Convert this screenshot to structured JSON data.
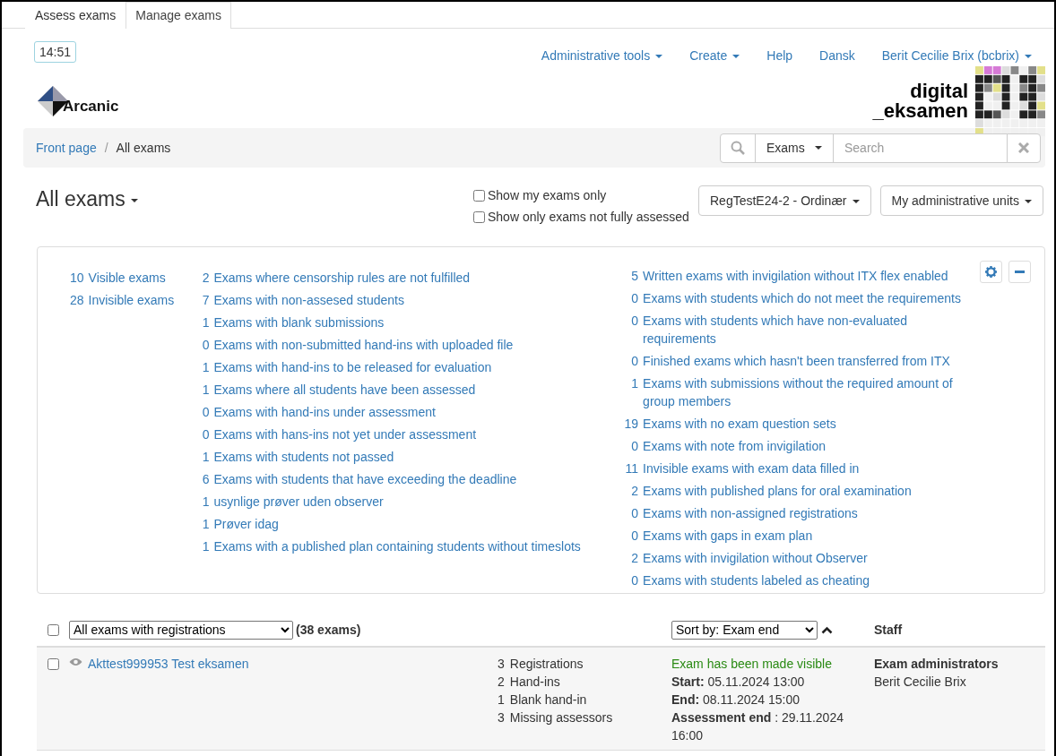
{
  "tabs": [
    {
      "label": "Assess exams",
      "selected": false
    },
    {
      "label": "Manage exams",
      "selected": true
    }
  ],
  "clock": "14:51",
  "nav": [
    {
      "label": "Administrative tools",
      "dropdown": true
    },
    {
      "label": "Create",
      "dropdown": true
    },
    {
      "label": "Help",
      "dropdown": false
    },
    {
      "label": "Dansk",
      "dropdown": false
    },
    {
      "label": "Berit Cecilie Brix (bcbrix)",
      "dropdown": true
    }
  ],
  "brand": {
    "left": "Arcanic",
    "right_line_1": "digital",
    "right_line_2": "_eksamen"
  },
  "breadcrumb": [
    {
      "label": "Front page",
      "link": true
    },
    {
      "label": "All exams",
      "link": false
    }
  ],
  "breadcrumb_separator": "/",
  "search": {
    "scope": "Exams",
    "placeholder": "Search"
  },
  "title": "All exams",
  "filters": [
    {
      "label": "Show my exams only",
      "checked": false
    },
    {
      "label": "Show only exams not fully assessed",
      "checked": false
    }
  ],
  "dropdowns": [
    "RegTestE24-2 - Ordinær",
    "My administrative units"
  ],
  "summary": {
    "columns": [
      [
        {
          "count": "10",
          "text": "Visible exams"
        },
        {
          "count": "28",
          "text": "Invisible exams"
        }
      ],
      [
        {
          "count": "2",
          "text": "Exams where censorship rules are not fulfilled"
        },
        {
          "count": "7",
          "text": "Exams with non-assesed students"
        },
        {
          "count": "1",
          "text": "Exams with blank submissions"
        },
        {
          "count": "0",
          "text": "Exams with non-submitted hand-ins with uploaded file"
        },
        {
          "count": "1",
          "text": "Exams with hand-ins to be released for evaluation"
        },
        {
          "count": "1",
          "text": "Exams where all students have been assessed"
        },
        {
          "count": "0",
          "text": "Exams with hand-ins under assessment"
        },
        {
          "count": "0",
          "text": "Exams with hans-ins not yet under assessment"
        },
        {
          "count": "1",
          "text": "Exams with students not passed"
        },
        {
          "count": "6",
          "text": "Exams with students that have exceeding the deadline"
        },
        {
          "count": "1",
          "text": "usynlige prøver uden observer"
        },
        {
          "count": "1",
          "text": "Prøver idag"
        },
        {
          "count": "1",
          "text": "Exams with a published plan containing students without timeslots"
        }
      ],
      [
        {
          "count": "5",
          "text": "Written exams with invigilation without ITX flex enabled"
        },
        {
          "count": "0",
          "text": "Exams with students which do not meet the requirements"
        },
        {
          "count": "0",
          "text": "Exams with students which have non-evaluated requirements"
        },
        {
          "count": "0",
          "text": "Finished exams which hasn't been transferred from ITX"
        },
        {
          "count": "1",
          "text": "Exams with submissions without the required amount of group members"
        },
        {
          "count": "19",
          "text": "Exams with no exam question sets"
        },
        {
          "count": "0",
          "text": "Exams with note from invigilation"
        },
        {
          "count": "11",
          "text": "Invisible exams with exam data filled in"
        },
        {
          "count": "2",
          "text": "Exams with published plans for oral examination"
        },
        {
          "count": "0",
          "text": "Exams with non-assigned registrations"
        },
        {
          "count": "0",
          "text": "Exams with gaps in exam plan"
        },
        {
          "count": "2",
          "text": "Exams with invigilation without Observer"
        },
        {
          "count": "0",
          "text": "Exams with students labeled as cheating"
        }
      ]
    ]
  },
  "table": {
    "select_all_checked": false,
    "filter": "All exams with registrations",
    "count": "(38 exams)",
    "sort": "Sort by: Exam end",
    "staff_heading": "Staff",
    "rows": [
      {
        "selected": false,
        "visible": true,
        "name": "Akttest999953 Test eksamen",
        "stats": [
          {
            "count": "3",
            "label": "Registrations"
          },
          {
            "count": "2",
            "label": "Hand-ins"
          },
          {
            "count": "1",
            "label": "Blank hand-in"
          },
          {
            "count": "3",
            "label": "Missing assessors"
          }
        ],
        "status": {
          "kind": "success",
          "text": "Exam has been made visible"
        },
        "dates": [
          {
            "label": "Start:",
            "value": "05.11.2024 13:00"
          },
          {
            "label": "End:",
            "value": "08.11.2024 15:00"
          },
          {
            "label": "Assessment end",
            "value": ": 29.11.2024 16:00"
          }
        ],
        "staff": [
          {
            "role": "Exam administrators",
            "names": [
              "Berit Cecilie Brix"
            ]
          }
        ]
      }
    ]
  }
}
